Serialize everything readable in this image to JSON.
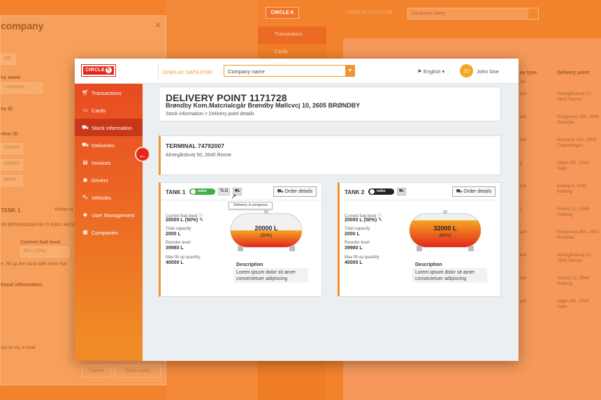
{
  "background": {
    "modal": {
      "title": "company",
      "labels": [
        "ny name",
        "ny ID",
        "rtner ID",
        "Current fuel level",
        "tional information"
      ],
      "values": [
        "c Company",
        "209",
        "1210001",
        "1108201",
        "2th001",
        "200 L (10%)"
      ],
      "tank_text": "TANK 1",
      "tank_badge": "miles",
      "tank_hint": "Yellow ta",
      "address": "96 BIRKEMOSEVEJ 5 8361 HASSEL",
      "fill_text": "e, fill up the tank with more fue",
      "email_text": "ion to my e-mail",
      "cancel": "Cancel",
      "place_order": "Place order"
    },
    "topbar": {
      "logo": "CIRCLE K",
      "display_label": "DISPLAY DATA FOR",
      "company_placeholder": "Company name"
    },
    "sidebar": [
      "Transactions",
      "Cards"
    ],
    "table": {
      "headers": [
        "ey type",
        "Delivery point"
      ],
      "filter": "All",
      "rows": [
        [
          "ard",
          "Almegårdsvej 12, 2640 Rønne"
        ],
        [
          "ard",
          "Norgesvej 294, 2640 Roskilde"
        ],
        [
          "ard",
          "Westend 150, 1500 Copenhagen"
        ],
        [
          "y",
          "Digel 265, 2034 Vejle"
        ],
        [
          "ard",
          "Sallvej 9, 1232 Kolding"
        ],
        [
          "y",
          "Violvej 12, 2640 Aalborg"
        ],
        [
          "ard",
          "Norgesvej 284, 2952 Roskilde"
        ],
        [
          "ard",
          "Almegårdsvej 12, 2640 Rønne"
        ],
        [
          "ard",
          "Violvej 12, 2640 Aalborg"
        ],
        [
          "ard",
          "Digel 265, 2034 Vejle"
        ]
      ]
    }
  },
  "topbar": {
    "logo": "CIRCLE",
    "logo_k": "K",
    "display_label": "DISPLAY DATA FOR:",
    "company_placeholder": "Company name",
    "language": "English ▾",
    "avatar_initials": "JD",
    "user_name": "John Doe"
  },
  "sidebar": {
    "items": [
      {
        "label": "Transactions",
        "icon": "cart-icon"
      },
      {
        "label": "Cards",
        "icon": "card-icon"
      },
      {
        "label": "Stock information",
        "icon": "truck-icon"
      },
      {
        "label": "Deliveries",
        "icon": "truck-icon"
      },
      {
        "label": "Invoices",
        "icon": "invoice-icon"
      },
      {
        "label": "Drivers",
        "icon": "driver-icon"
      },
      {
        "label": "Vehicles",
        "icon": "car-icon"
      },
      {
        "label": "User Management",
        "icon": "users-icon"
      },
      {
        "label": "Companies",
        "icon": "building-icon"
      }
    ],
    "active": "Stock information"
  },
  "page": {
    "title": "DELIVERY POINT 1171728",
    "address": "Brøndby Kom.Matcrialcgår Brøndby Møllcvcj 10, 2605 BRØNDBY",
    "breadcrumb": "Stock information > Delivery point details"
  },
  "terminal": {
    "title": "TERMINAL 74792007",
    "address": "Almegårdsvej 50, 2640 Ronne"
  },
  "tanks": [
    {
      "name": "TANK 1",
      "badge": "miles",
      "badge_color": "#3cb045",
      "tlg": "TLG",
      "order_label": "Order details",
      "tooltip": "Delivery in progress",
      "current_label": "Current fuel level",
      "current_value": "20000 L (50%)",
      "capacity_label": "Total capacity",
      "capacity_value": "2000 L",
      "reorder_label": "Reorder level",
      "reorder_value": "39980 L",
      "max_label": "Max fill up quantity",
      "max_value": "40000 L",
      "fill_amount": "20000 L",
      "fill_pct": "(50%)",
      "fill_level": 0.5,
      "desc_label": "Description",
      "desc_text": "Lorem ipsum dolor sit amet consectetuer adipiscing"
    },
    {
      "name": "TANK 2",
      "badge": "miles",
      "badge_color": "#222222",
      "order_label": "Order details",
      "current_label": "Current fuel level",
      "current_value": "20000 L (50%)",
      "capacity_label": "Total capacity",
      "capacity_value": "2000 L",
      "reorder_label": "Reorder level",
      "reorder_value": "39980 L",
      "max_label": "Max fill up quantity",
      "max_value": "40000 L",
      "fill_amount": "32000 L",
      "fill_pct": "(80%)",
      "fill_level": 0.8,
      "desc_label": "Description",
      "desc_text": "Lorem ipsum dolor sit amet consectetuer adipiscing"
    }
  ],
  "colors": {
    "brand": "#e4261c",
    "accent": "#f29530",
    "fuel_top": "#f5a623",
    "fuel_bottom": "#e4261c"
  }
}
